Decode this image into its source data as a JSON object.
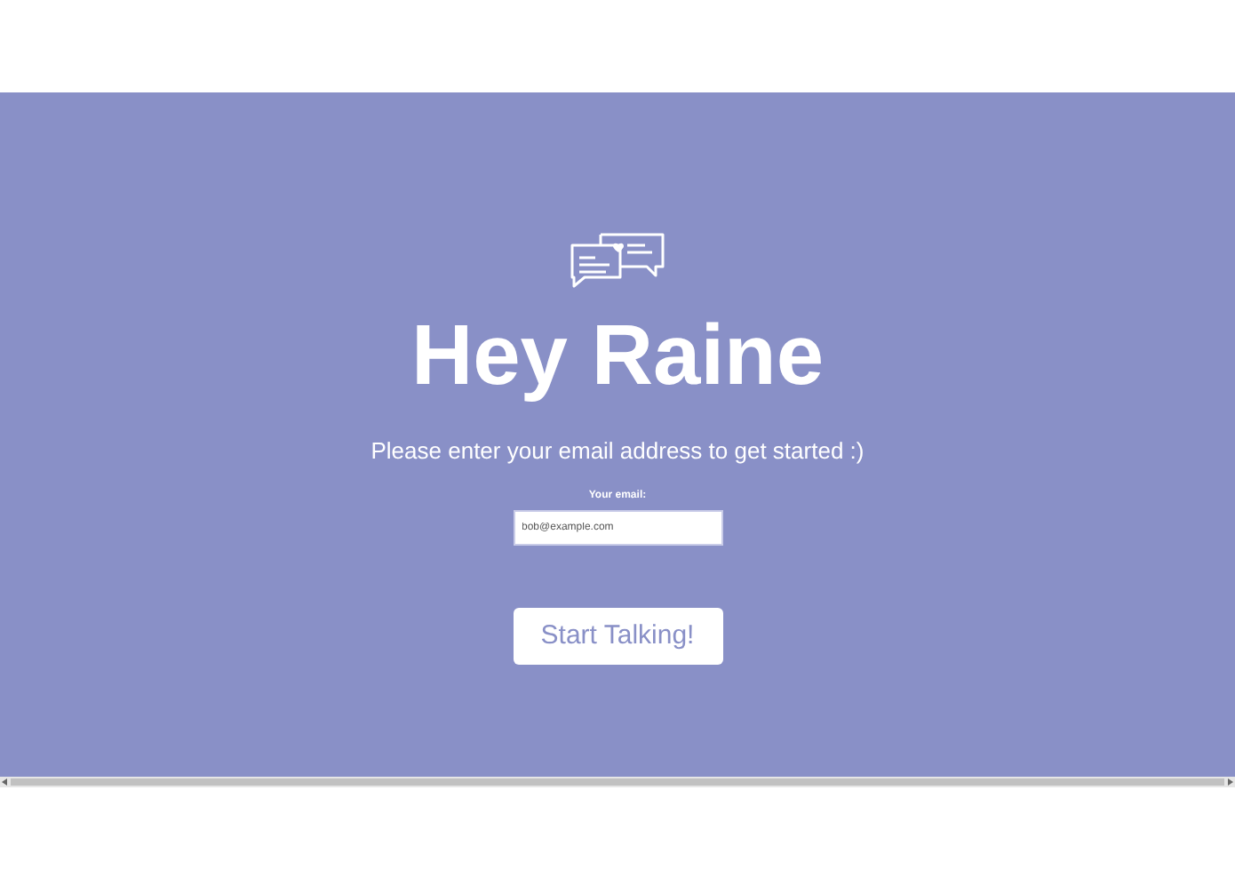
{
  "heading": "Hey Raine",
  "subtitle": "Please enter your email address to get started :)",
  "email_field": {
    "label": "Your email:",
    "value": "bob@example.com"
  },
  "button": "Start Talking!"
}
